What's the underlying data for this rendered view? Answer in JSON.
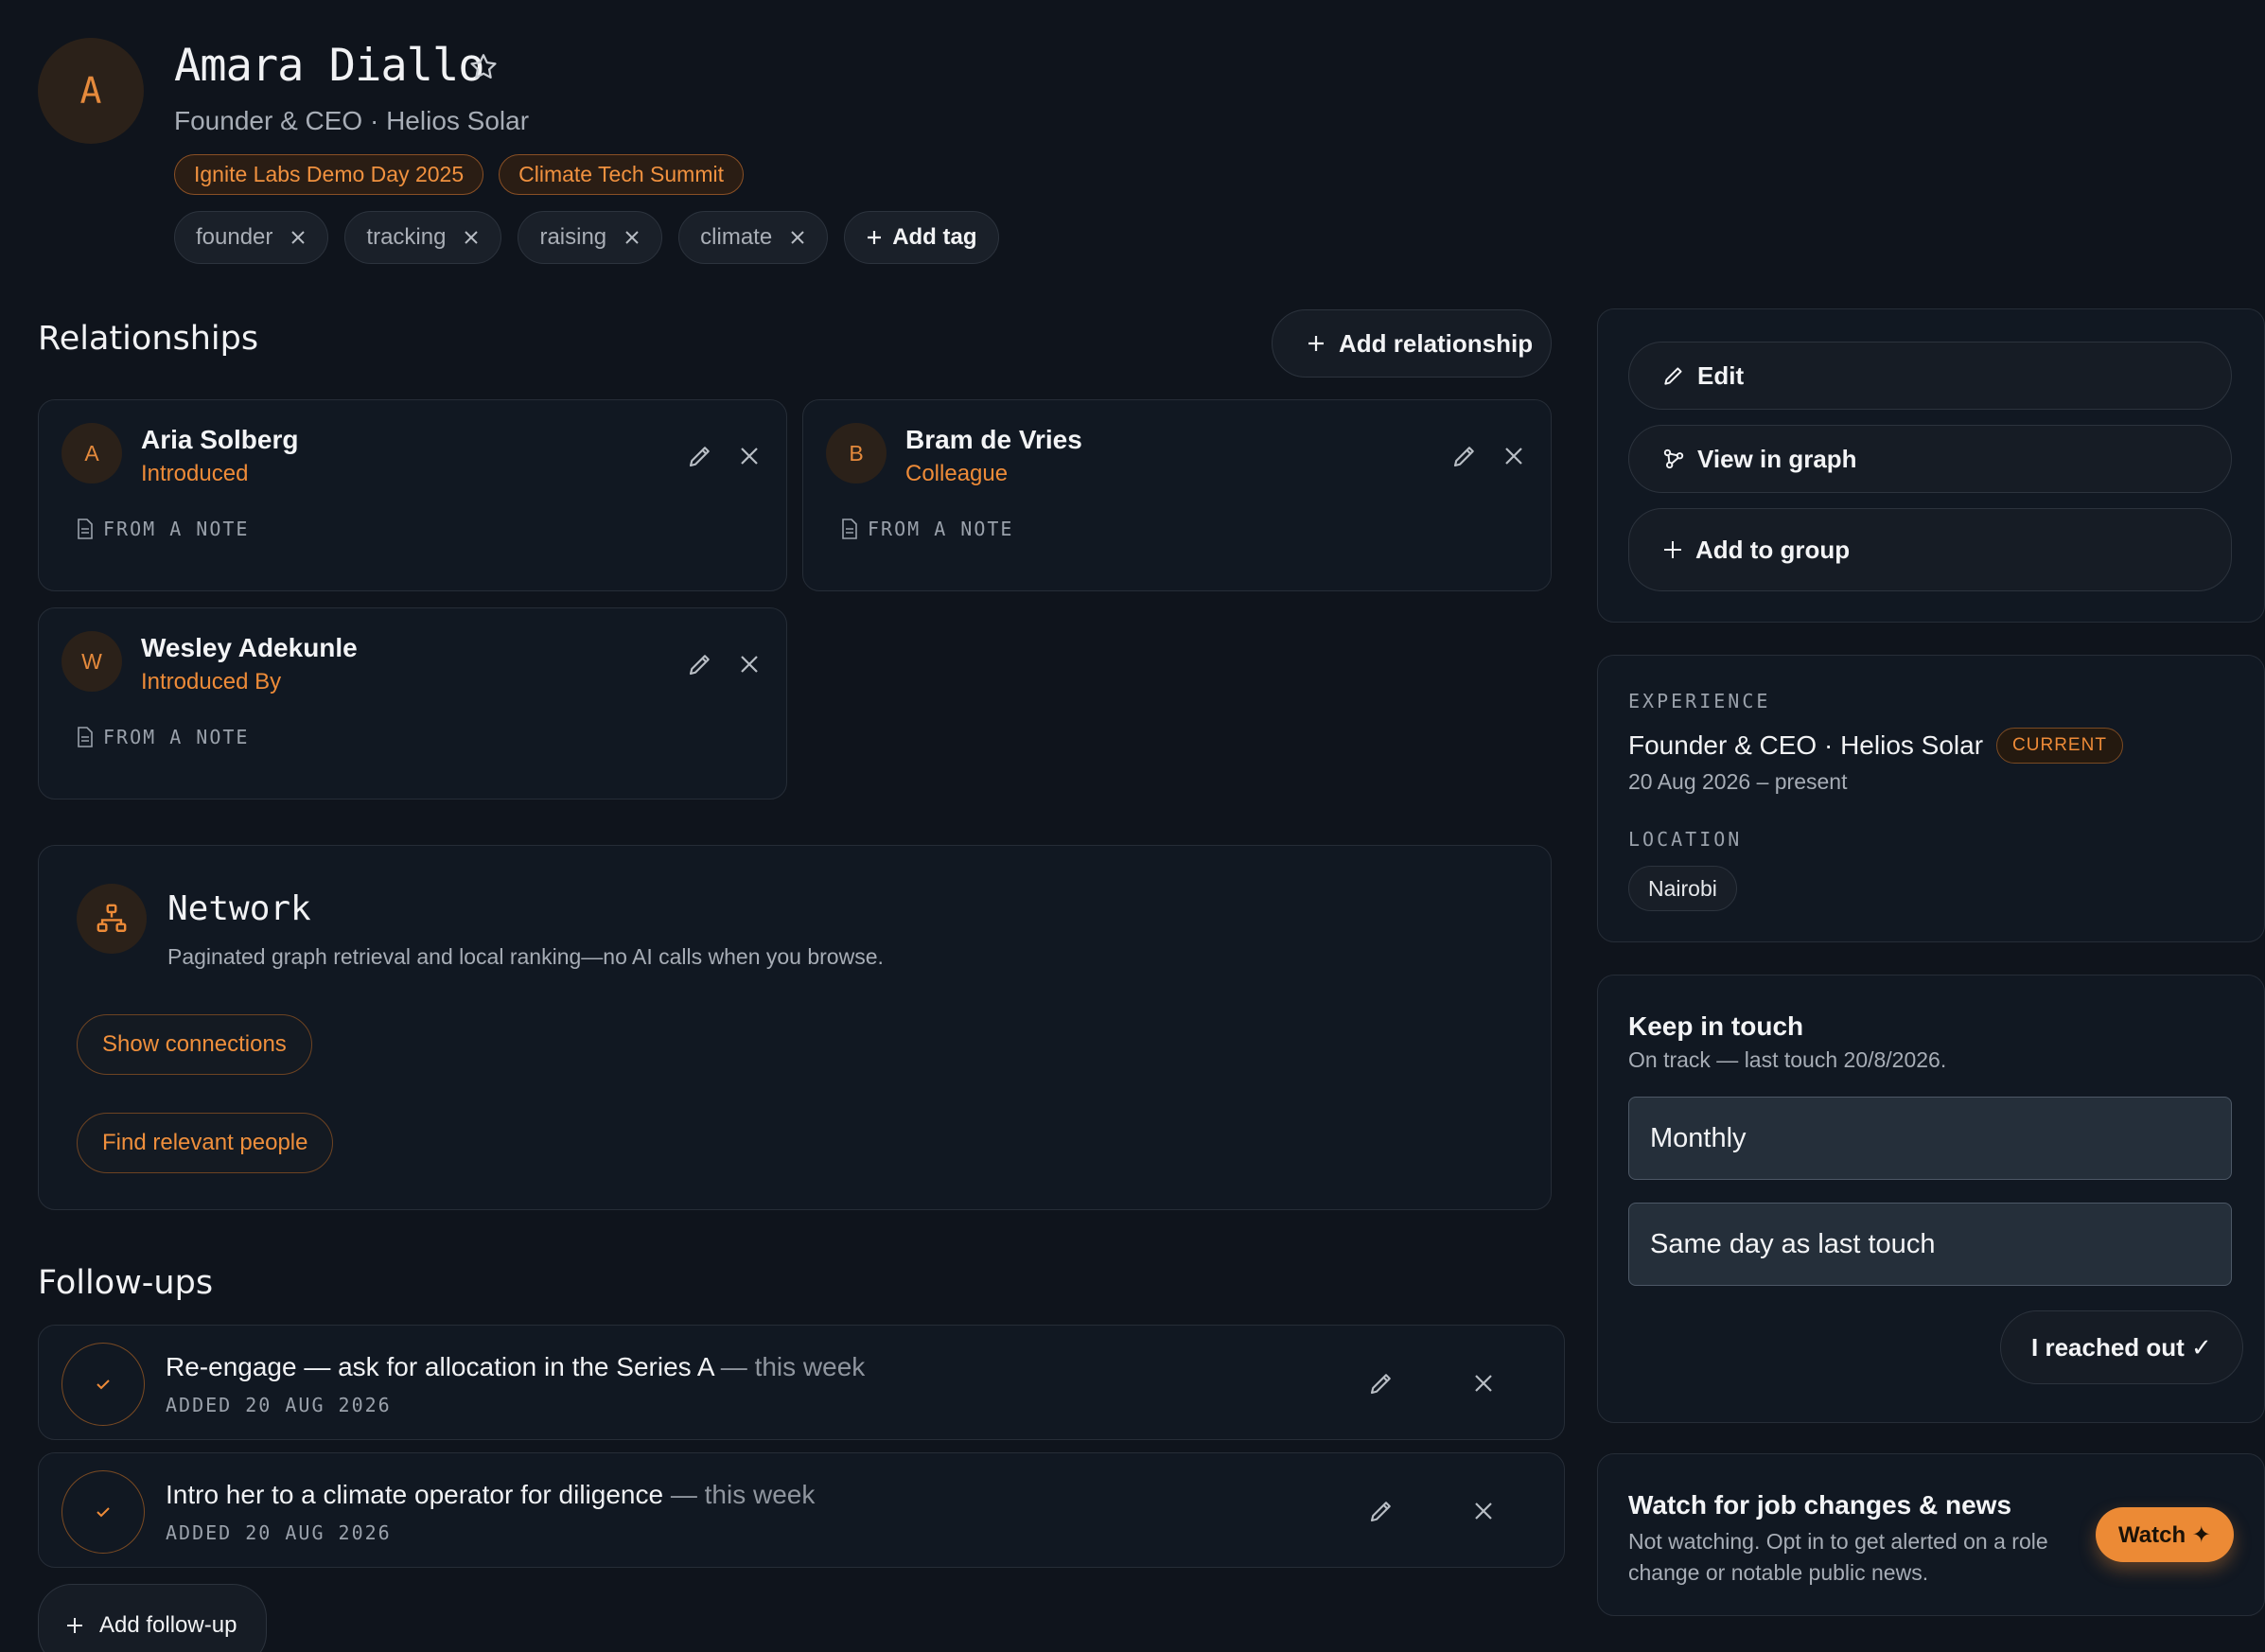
{
  "colors": {
    "accent": "#ec8a35",
    "background": "#0f141c",
    "card": "#111822"
  },
  "person": {
    "initial": "A",
    "name": "Amara Diallo",
    "subtitle": "Founder & CEO · Helios Solar",
    "event_tags": [
      "Ignite Labs Demo Day 2025",
      "Climate Tech Summit"
    ],
    "tags": [
      "founder",
      "tracking",
      "raising",
      "climate"
    ],
    "add_tag_label": "Add tag",
    "star_icon": "star-icon"
  },
  "relationships": {
    "title": "Relationships",
    "add_label": "Add relationship",
    "items": [
      {
        "initial": "A",
        "name": "Aria Solberg",
        "type": "Introduced",
        "source": "FROM A NOTE"
      },
      {
        "initial": "B",
        "name": "Bram de Vries",
        "type": "Colleague",
        "source": "FROM A NOTE"
      },
      {
        "initial": "W",
        "name": "Wesley Adekunle",
        "type": "Introduced By",
        "source": "FROM A NOTE"
      }
    ]
  },
  "network": {
    "title": "Network",
    "description": "Paginated graph retrieval and local ranking—no AI calls when you browse.",
    "show_connections": "Show connections",
    "find_people": "Find relevant people"
  },
  "followups": {
    "title": "Follow-ups",
    "items": [
      {
        "text": "Re-engage — ask for allocation in the Series A",
        "when": " — this week",
        "added": "ADDED 20 AUG 2026"
      },
      {
        "text": "Intro her to a climate operator for diligence",
        "when": " — this week",
        "added": "ADDED 20 AUG 2026"
      }
    ],
    "add_label": "Add follow-up"
  },
  "actions": {
    "edit": "Edit",
    "view_graph": "View in graph",
    "add_group": "Add to group"
  },
  "experience": {
    "label": "EXPERIENCE",
    "role": "Founder & CEO · Helios Solar",
    "badge": "CURRENT",
    "dates": "20 Aug 2026 – present",
    "location_label": "LOCATION",
    "location": "Nairobi"
  },
  "keep_in_touch": {
    "title": "Keep in touch",
    "status": "On track — last touch 20/8/2026.",
    "frequency": "Monthly",
    "anchor": "Same day as last touch",
    "reached_out": "I reached out ✓"
  },
  "watch": {
    "title": "Watch for job changes & news",
    "description": "Not watching. Opt in to get alerted on a role change or notable public news.",
    "button": "Watch ✦"
  }
}
